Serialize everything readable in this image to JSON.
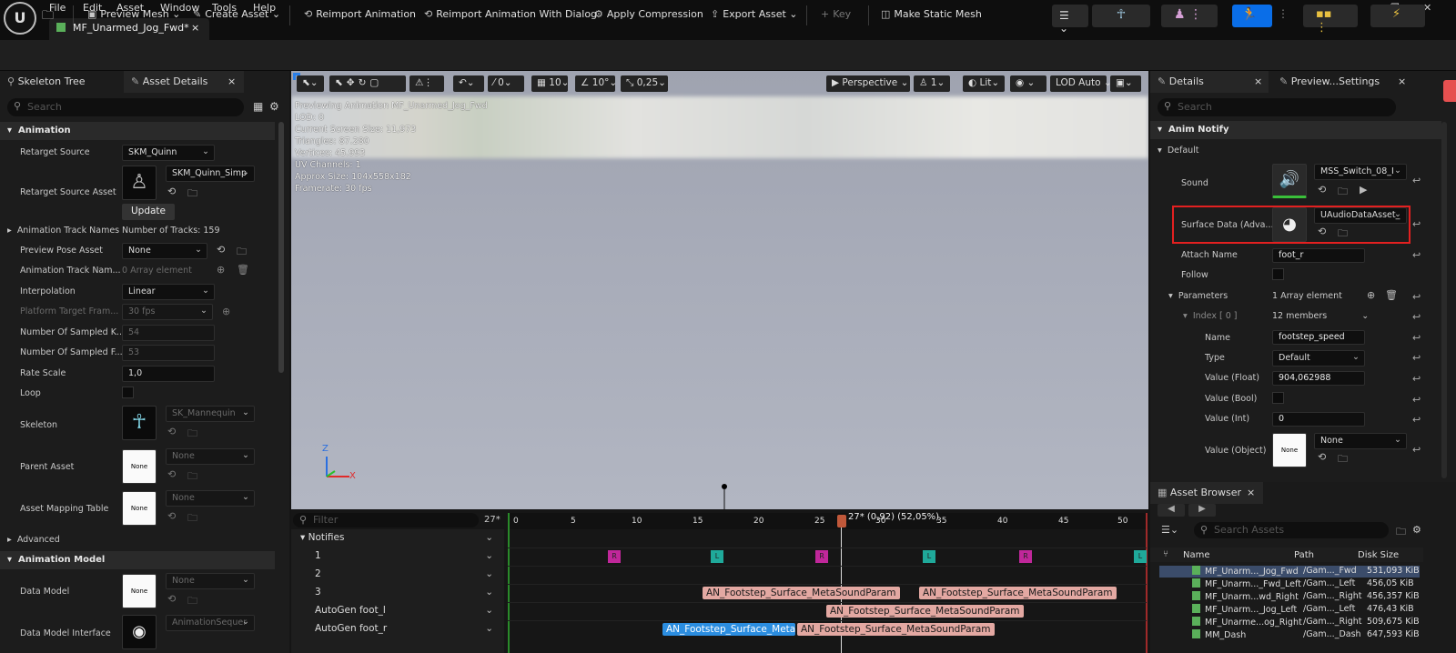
{
  "app": {
    "logo": "U",
    "menu": [
      "File",
      "Edit",
      "Asset",
      "Window",
      "Tools",
      "Help"
    ]
  },
  "doc_tab": {
    "title": "MF_Unarmed_Jog_Fwd*",
    "close": "×"
  },
  "toolbar": {
    "preview_mesh": "Preview Mesh",
    "create_asset": "Create Asset",
    "reimport": "Reimport Animation",
    "reimport_dialog": "Reimport Animation With Dialog",
    "apply_compression": "Apply Compression",
    "export_asset": "Export Asset",
    "key": "Key",
    "make_static_mesh": "Make Static Mesh"
  },
  "left_panel": {
    "tabs": [
      "Skeleton Tree",
      "Asset Details"
    ],
    "search_placeholder": "Search",
    "sections": {
      "animation": "Animation",
      "advanced": "Advanced",
      "animation_model": "Animation Model"
    },
    "rows": {
      "retarget_source": {
        "label": "Retarget Source",
        "value": "SKM_Quinn"
      },
      "retarget_source_asset": {
        "label": "Retarget Source Asset",
        "value": "SKM_Quinn_Simp",
        "button": "Update"
      },
      "animation_track_names": {
        "label": "Animation Track Names",
        "value": "Number of Tracks: 159"
      },
      "preview_pose_asset": {
        "label": "Preview Pose Asset",
        "value": "None"
      },
      "animation_track_nam": {
        "label": "Animation Track Nam...",
        "value": "0 Array element"
      },
      "interpolation": {
        "label": "Interpolation",
        "value": "Linear"
      },
      "platform_target": {
        "label": "Platform Target Fram...",
        "value": "30 fps"
      },
      "sampled_k": {
        "label": "Number Of Sampled K...",
        "value": "54"
      },
      "sampled_f": {
        "label": "Number Of Sampled F...",
        "value": "53"
      },
      "rate_scale": {
        "label": "Rate Scale",
        "value": "1,0"
      },
      "loop": {
        "label": "Loop"
      },
      "skeleton": {
        "label": "Skeleton",
        "value": "SK_Mannequin"
      },
      "parent_asset": {
        "label": "Parent Asset",
        "value": "None",
        "thumb": "None"
      },
      "asset_mapping": {
        "label": "Asset Mapping Table",
        "value": "None",
        "thumb": "None"
      },
      "data_model": {
        "label": "Data Model",
        "value": "None",
        "thumb": "None"
      },
      "data_model_interface": {
        "label": "Data Model Interface",
        "value": "AnimationSequer"
      }
    }
  },
  "viewport": {
    "toolbar": {
      "v0": "0",
      "v10": "10",
      "v10deg": "10°",
      "scale": "0,25",
      "perspective": "Perspective",
      "cam": "1",
      "lit": "Lit",
      "lod": "LOD Auto"
    },
    "stats": [
      "Previewing Animation MF_Unarmed_Jog_Fwd",
      "LOD: 0",
      "Current Screen Size: 11,973",
      "Triangles: 87.280",
      "Vertices: 45.993",
      "UV Channels: 1",
      "Approx Size: 104x558x182",
      "Framerate: 30 fps"
    ],
    "axis_z": "Z",
    "axis_x": "X"
  },
  "timeline": {
    "filter_placeholder": "Filter",
    "frame_count": "27*",
    "playhead": "27* (0,92) (52,05%)",
    "ruler": [
      "0",
      "5",
      "10",
      "15",
      "20",
      "25",
      "30",
      "35",
      "40",
      "45",
      "50"
    ],
    "tracks": [
      "Notifies",
      "1",
      "2",
      "3",
      "AutoGen foot_l",
      "AutoGen foot_r"
    ],
    "markers": {
      "r": "R",
      "l": "L"
    },
    "notify_label": "AN_Footstep_Surface_MetaSoundParam",
    "notify_label_short": "AN_Footstep_Surface_MetaS"
  },
  "right_panel": {
    "tabs": [
      "Details",
      "Preview...Settings"
    ],
    "search_placeholder": "Search",
    "anim_notify": "Anim Notify",
    "default": "Default",
    "sound": {
      "label": "Sound",
      "value": "MSS_Switch_08_I"
    },
    "surface_data": {
      "label": "Surface Data (Adva...",
      "value": "UAudioDataAsset_"
    },
    "attach_name": {
      "label": "Attach Name",
      "value": "foot_r"
    },
    "follow": {
      "label": "Follow"
    },
    "parameters": {
      "label": "Parameters",
      "value": "1 Array element"
    },
    "index": {
      "label": "Index [ 0 ]",
      "value": "12 members"
    },
    "name": {
      "label": "Name",
      "value": "footstep_speed"
    },
    "type": {
      "label": "Type",
      "value": "Default"
    },
    "value_float": {
      "label": "Value (Float)",
      "value": "904,062988"
    },
    "value_bool": {
      "label": "Value (Bool)"
    },
    "value_int": {
      "label": "Value (Int)",
      "value": "0"
    },
    "value_object": {
      "label": "Value (Object)",
      "value": "None",
      "thumb": "None"
    }
  },
  "asset_browser": {
    "title": "Asset Browser",
    "search_placeholder": "Search Assets",
    "columns": [
      "Name",
      "Path",
      "Disk Size"
    ],
    "rows": [
      {
        "name": "MF_Unarm..._Jog_Fwd",
        "path": "/Gam..._Fwd",
        "size": "531,093 KiB"
      },
      {
        "name": "MF_Unarm..._Fwd_Left",
        "path": "/Gam..._Left",
        "size": "456,05 KiB"
      },
      {
        "name": "MF_Unarm...wd_Right",
        "path": "/Gam..._Right",
        "size": "456,357 KiB"
      },
      {
        "name": "MF_Unarm..._Jog_Left",
        "path": "/Gam..._Left",
        "size": "476,43 KiB"
      },
      {
        "name": "MF_Unarme...og_Right",
        "path": "/Gam..._Right",
        "size": "509,675 KiB"
      },
      {
        "name": "MM_Dash",
        "path": "/Gam..._Dash",
        "size": "647,593 KiB"
      }
    ]
  },
  "colors": {
    "accent": "#0a6ee8",
    "highlight": "#e32020",
    "notify_pink": "#e3a8a2",
    "notify_blue": "#2b8de0"
  }
}
